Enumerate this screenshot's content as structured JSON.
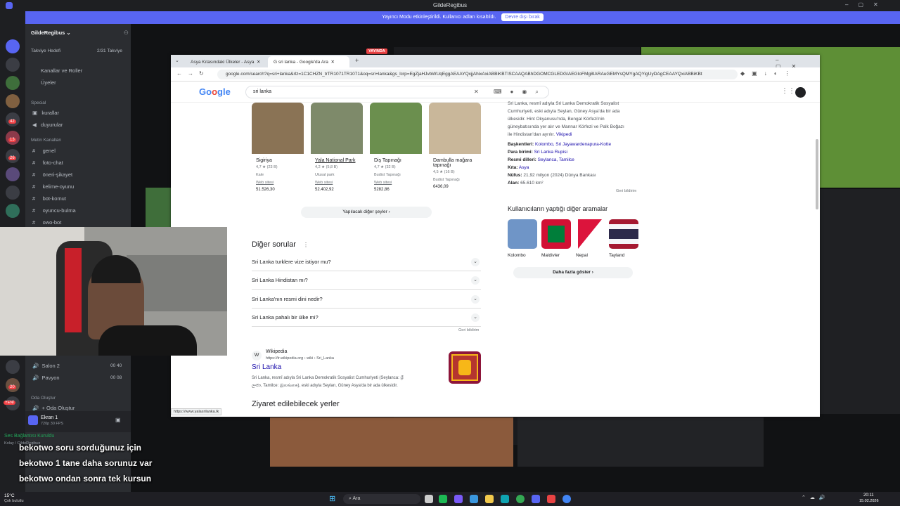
{
  "discord": {
    "window_title": "GildeRegibus",
    "stream_banner": "Yayıncı Modu etkinleştirildi. Kullanıcı adları kısaltıldı.",
    "stream_banner_button": "Devre dışı bırak",
    "server_name": "GildeRegibus",
    "boost_goal_label": "Takviye Hedefi",
    "boost_goal_count": "2/31 Takviye",
    "top_items": [
      "Kanallar ve Roller",
      "Üyeler"
    ],
    "category_special": "Special",
    "special_channels": [
      "kurallar",
      "duyurular"
    ],
    "category_text": "Metin Kanalları",
    "text_channels": [
      "genel",
      "foto-chat",
      "öneri-şikayet",
      "kelime-oyunu",
      "bot-komut",
      "oyuncu-bulma",
      "owo-bot"
    ],
    "voice_channels": [
      {
        "name": "Salon 2",
        "count": "00",
        "limit": "40"
      },
      {
        "name": "Pavyon",
        "count": "00",
        "limit": "08"
      }
    ],
    "category_create": "Oda Oluştur",
    "create_channel": "Oda Oluştur",
    "screen_share_label": "Ekran 1",
    "screen_share_sub": "720p 30 FPS",
    "voice_connected": "Ses Bağlantısı Kuruldu",
    "voice_connected_sub": "Kolay / GildeRegibus",
    "new_badge": "YENİ",
    "badge_counts": [
      "42",
      "13",
      "26",
      "20"
    ]
  },
  "chat_overlay": [
    {
      "user": "bekotwo",
      "message": "soru sorduğunuz için"
    },
    {
      "user": "bekotwo",
      "message": "1 tane daha sorunuz var"
    },
    {
      "user": "bekotwo",
      "message": "ondan sonra tek kursun"
    }
  ],
  "browser": {
    "tabs": [
      "Asya Kıtasındaki Ülkeler - Asya",
      "sri lanka - Google'da Ara"
    ],
    "url": "google.com/search?q=sri+lanka&rlz=1C1CHZN_trTR1071TR1071&oq=sri+lanka&gs_lcrp=EgZjaHJvbWUqEggAEAAYQxjjAhixAxiABBiKBTISCAAQABhDGOMCGLEDGIAEGIoFMg8IARAuGEMYsQMYgAQYigUyDAgCEAAYQxiABBiKBt",
    "search_query": "sri lanka",
    "status_url": "https://www.yalasrilanka.lk",
    "yayinda_badge": "YAYINDA"
  },
  "places": [
    {
      "name": "Sigiriya",
      "rating": "4,7 ★ (23 B)",
      "type": "Kale",
      "link": "Web sitesi",
      "price": "51.526,30",
      "color": "#8a7355"
    },
    {
      "name": "Yala National Park",
      "rating": "4,2 ★ (5,8 B)",
      "type": "Ulusal park",
      "link": "Web sitesi",
      "price": "52.402,92",
      "color": "#7e8a6a"
    },
    {
      "name": "Diş Tapınağı",
      "rating": "4,7 ★ (32 B)",
      "type": "Budist Tapınağı",
      "link": "Web sitesi",
      "price": "5282,86",
      "color": "#6b8f4e"
    },
    {
      "name": "Dambulla mağara tapınağı",
      "rating": "4,5 ★ (16 B)",
      "type": "Budist Tapınağı",
      "link": "",
      "price": "6436,09",
      "color": "#c9b79a"
    }
  ],
  "more_things_button": "Yapılacak diğer şeyler",
  "paa": {
    "heading": "Diğer sorular",
    "questions": [
      "Sri Lanka turklere vize istiyor mu?",
      "Sri Lanka Hindistan mı?",
      "Sri Lanka'nın resmi dini nedir?",
      "Sri Lanka pahalı bir ülke mi?"
    ],
    "feedback": "Geri bildirim"
  },
  "result": {
    "source": "Wikipedia",
    "source_url": "https://tr.wikipedia.org › wiki › Sri_Lanka",
    "title": "Sri Lanka",
    "snippet_1": "Sri Lanka, resmî adıyla Sri Lanka Demokratik Sosyalist Cumhuriyeti (Seylanca: ශ්‍රී",
    "snippet_2": "ලංකා, Tamilce: இலங்கை), eski adıyla Seylan, Güney Asya'da bir ada ülkesidir."
  },
  "places_heading": "Ziyaret edilebilecek yerler",
  "knowledge_panel": {
    "desc_1": "Sri Lanka, resmî adıyla Sri Lanka Demokratik Sosyalist",
    "desc_2": "Cumhuriyeti, eski adıyla Seylan, Güney Asya'da bir ada",
    "desc_3": "ülkesidir. Hint Okyanusu'nda, Bengal Körfezi'nin",
    "desc_4": "güneybatısında yer alır ve Mannar Körfezi ve Palk Boğazı",
    "desc_5": "ile Hindistan'dan ayrılır.",
    "desc_link": "Vikipedi",
    "facts": [
      {
        "label": "Başkentleri:",
        "value": "Kolombo, Sri Jayawardenapura-Kotte"
      },
      {
        "label": "Para birimi:",
        "value": "Sri Lanka Rupisi"
      },
      {
        "label": "Resmi dilleri:",
        "value": "Seylanca, Tamilce"
      },
      {
        "label": "Kıta:",
        "value": "Asya"
      },
      {
        "label": "Nüfus:",
        "value": "21,92 milyon (2024) Dünya Bankası"
      },
      {
        "label": "Alan:",
        "value": "65.610 km²"
      }
    ],
    "feedback": "Geri bildirim",
    "also_search_heading": "Kullanıcıların yaptığı diğer aramalar",
    "also_search": [
      "Kolombo",
      "Maldivler",
      "Nepal",
      "Tayland"
    ],
    "show_more": "Daha fazla göster"
  },
  "taskbar": {
    "search_label": "Ara",
    "weather_temp": "15°C",
    "weather_desc": "Çok bulutlu",
    "time": "20:11",
    "date": "15.02.2026"
  }
}
